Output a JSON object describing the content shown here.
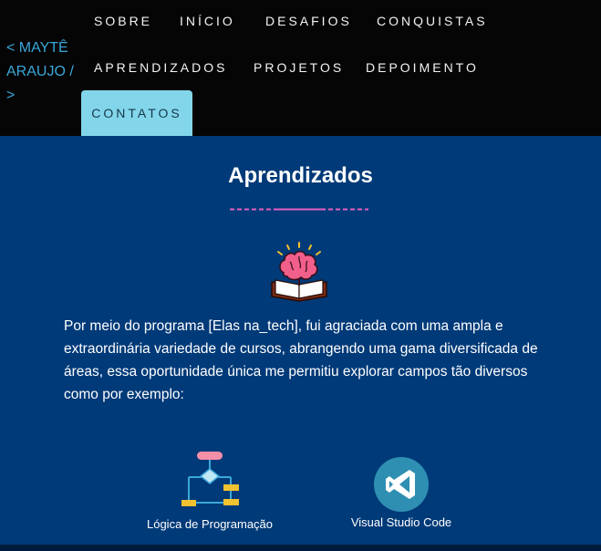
{
  "header": {
    "brand": "< MAYTÊ ARAUJO / >",
    "nav": [
      {
        "label": "SOBRE"
      },
      {
        "label": "INÍCIO"
      },
      {
        "label": "DESAFIOS"
      },
      {
        "label": "CONQUISTAS"
      },
      {
        "label": "APRENDIZADOS"
      },
      {
        "label": "PROJETOS"
      },
      {
        "label": "DEPOIMENTO"
      },
      {
        "label": "CONTATOS",
        "active": true
      }
    ]
  },
  "section": {
    "title": "Aprendizados",
    "icon": "brain-book-icon",
    "intro": "Por meio do programa [Elas na_tech], fui agraciada com uma ampla e extraordinária variedade de cursos, abrangendo uma gama diversificada de áreas, essa oportunidade única me permitiu explorar campos tão diversos como por exemplo:",
    "cards": [
      {
        "label": "Lógica de Programação",
        "icon": "flowchart-icon"
      },
      {
        "label": "Visual Studio Code",
        "icon": "vscode-icon"
      }
    ]
  },
  "colors": {
    "header_bg": "#050505",
    "page_bg": "#003a78",
    "brand": "#3aa7d9",
    "active_tab": "#83d6ea",
    "accent_line": "#e45fc0"
  }
}
